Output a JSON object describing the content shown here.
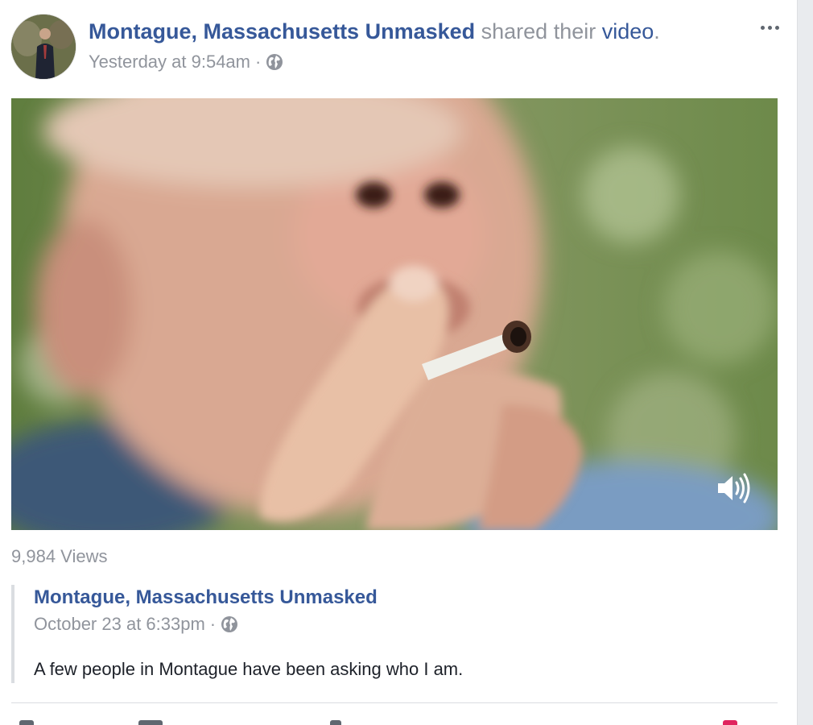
{
  "post": {
    "page_name": "Montague, Massachusetts Unmasked",
    "action_text": " shared their ",
    "action_link": "video",
    "action_end": ".",
    "timestamp": "Yesterday at 9:54am",
    "separator": "·",
    "privacy_icon": "globe-icon",
    "more_icon": "more-options-icon"
  },
  "video": {
    "views": "9,984 Views",
    "volume_icon": "volume-icon"
  },
  "shared_post": {
    "page_name": "Montague, Massachusetts Unmasked",
    "timestamp": "October 23 at 6:33pm",
    "separator": "·",
    "privacy_icon": "globe-icon",
    "text": "A few people in Montague have been asking who I am."
  },
  "colors": {
    "link_blue": "#365899",
    "muted_gray": "#90949c",
    "body_text": "#1d2129",
    "divider": "#dadde1",
    "rail": "#e9ebee"
  }
}
